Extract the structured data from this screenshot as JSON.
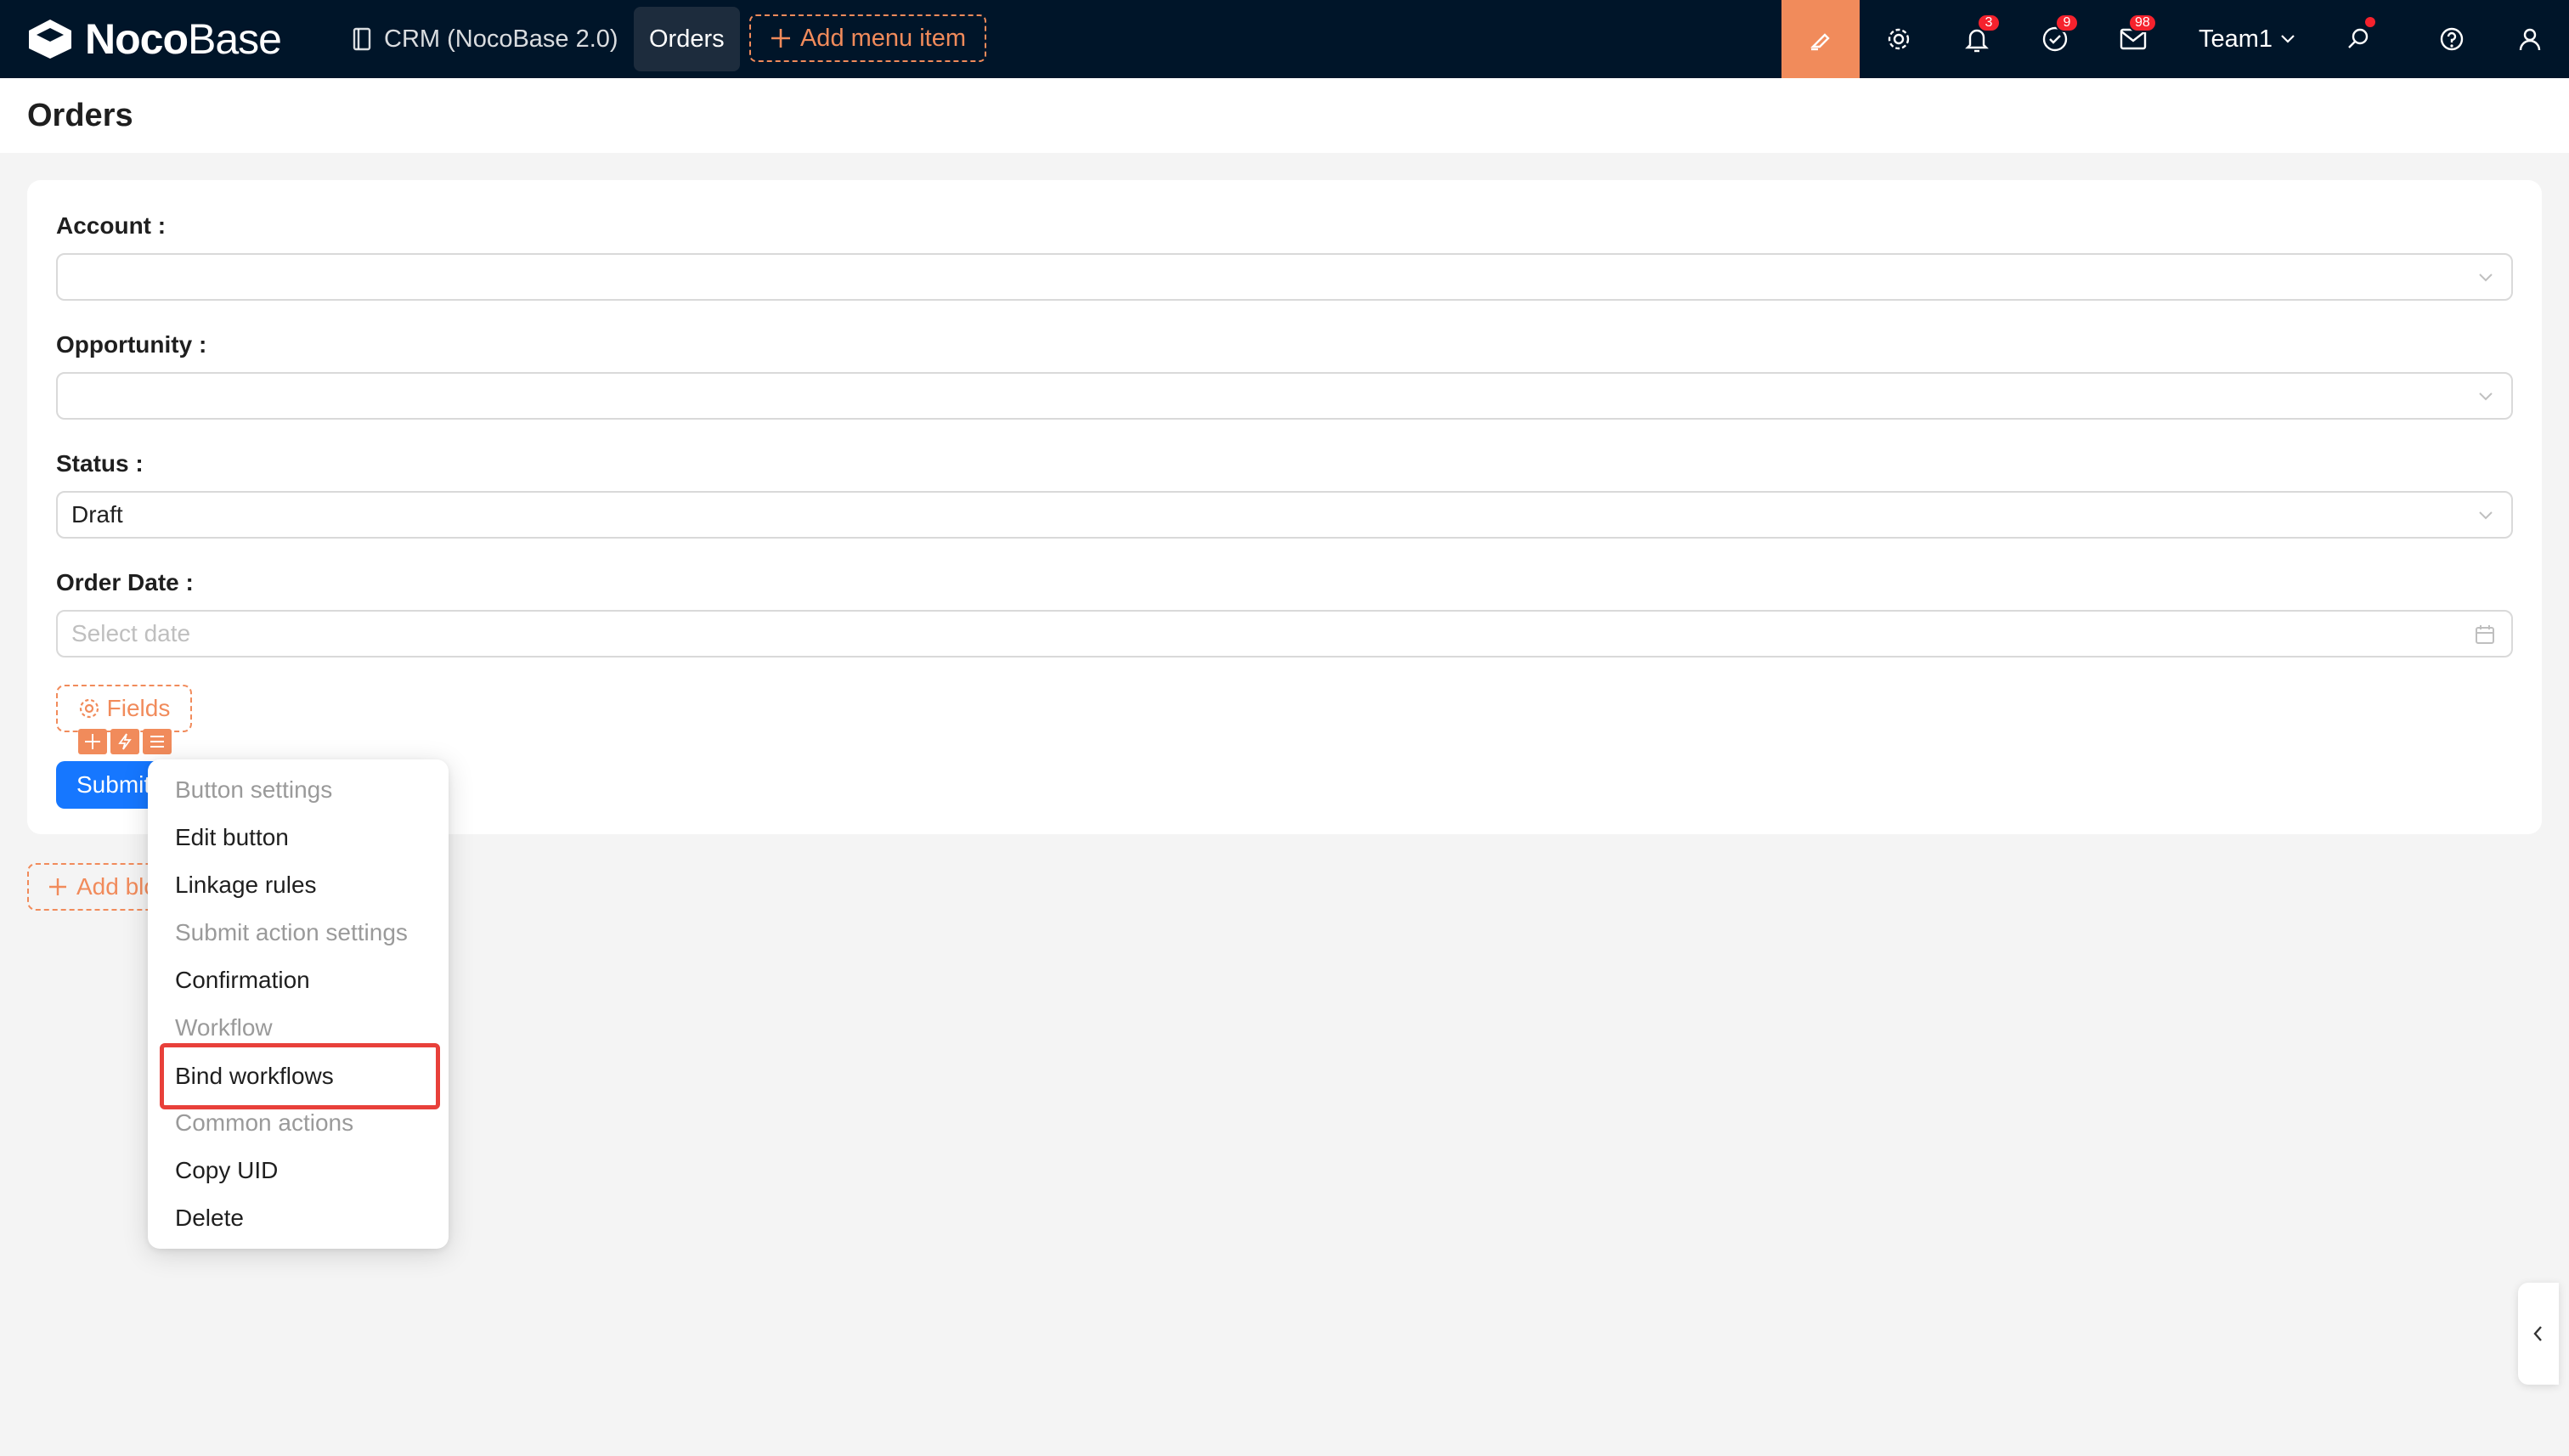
{
  "app": {
    "brand_bold": "Noco",
    "brand_light": "Base"
  },
  "nav": {
    "crm_label": "CRM (NocoBase 2.0)",
    "orders_label": "Orders",
    "add_menu_label": "Add menu item"
  },
  "toolbar": {
    "notifications_count": "3",
    "tasks_count": "9",
    "messages_count": "98",
    "team_label": "Team1"
  },
  "page": {
    "title": "Orders"
  },
  "form": {
    "account_label": "Account :",
    "account_value": "",
    "opportunity_label": "Opportunity :",
    "opportunity_value": "",
    "status_label": "Status :",
    "status_value": "Draft",
    "order_date_label": "Order Date :",
    "order_date_placeholder": "Select date",
    "fields_button": "Fields",
    "submit_button": "Submit",
    "add_block_button": "Add block"
  },
  "context_menu": {
    "items": [
      {
        "label": "Button settings",
        "type": "group"
      },
      {
        "label": "Edit button",
        "type": "item"
      },
      {
        "label": "Linkage rules",
        "type": "item"
      },
      {
        "label": "Submit action settings",
        "type": "group"
      },
      {
        "label": "Confirmation",
        "type": "item"
      },
      {
        "label": "Workflow",
        "type": "group"
      },
      {
        "label": "Bind workflows",
        "type": "item",
        "highlighted": true
      },
      {
        "label": "Common actions",
        "type": "group"
      },
      {
        "label": "Copy UID",
        "type": "item"
      },
      {
        "label": "Delete",
        "type": "item"
      }
    ]
  },
  "colors": {
    "topbar": "#001529",
    "accent": "#f18b5b",
    "primary": "#1677ff",
    "highlight_border": "#e8403a"
  }
}
